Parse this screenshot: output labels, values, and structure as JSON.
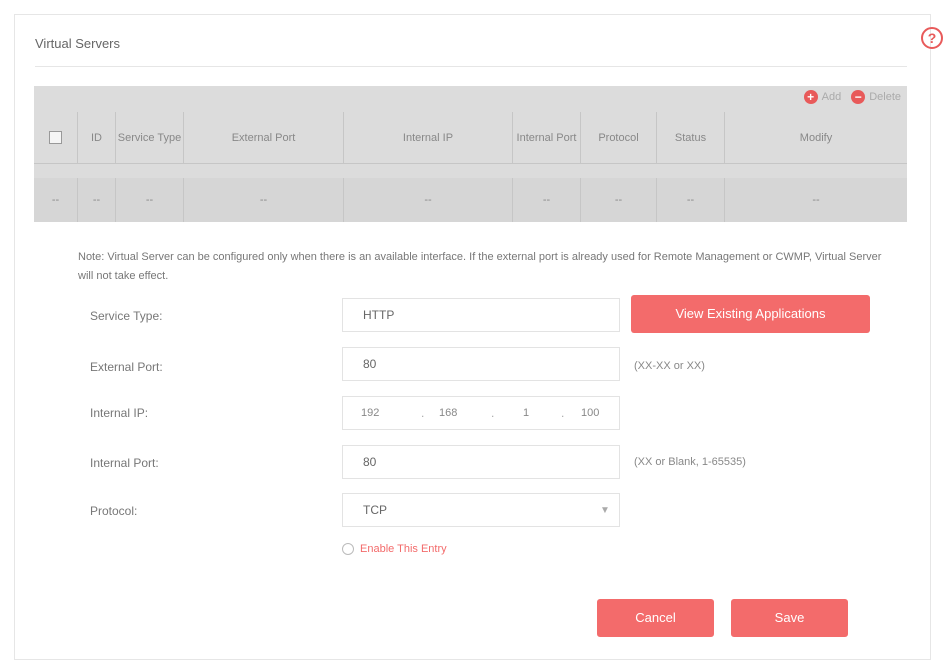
{
  "page": {
    "title": "Virtual Servers"
  },
  "help": {
    "icon": "help-icon"
  },
  "table": {
    "actions": {
      "add": "Add",
      "delete": "Delete"
    },
    "columns": [
      "",
      "ID",
      "Service Type",
      "External Port",
      "Internal IP",
      "Internal Port",
      "Protocol",
      "Status",
      "Modify"
    ],
    "row": [
      "--",
      "--",
      "--",
      "--",
      "--",
      "--",
      "--",
      "--",
      "--"
    ]
  },
  "form": {
    "note": "Note: Virtual Server can be configured only when there is an available interface. If the external port is already used for Remote Management or CWMP, Virtual Server will not take effect.",
    "service_type_label": "Service Type:",
    "service_type_value": "HTTP",
    "view_apps_label": "View Existing Applications",
    "external_port_label": "External Port:",
    "external_port_value": "80",
    "external_port_hint": "(XX-XX or XX)",
    "internal_ip_label": "Internal IP:",
    "internal_ip": [
      "192",
      "168",
      "1",
      "100"
    ],
    "internal_port_label": "Internal Port:",
    "internal_port_value": "80",
    "internal_port_hint": "(XX or Blank, 1-65535)",
    "protocol_label": "Protocol:",
    "protocol_value": "TCP",
    "enable_label": "Enable This Entry",
    "cancel_label": "Cancel",
    "save_label": "Save"
  },
  "colors": {
    "accent": "#f36b6b",
    "table_bg": "#dcdcdc"
  }
}
